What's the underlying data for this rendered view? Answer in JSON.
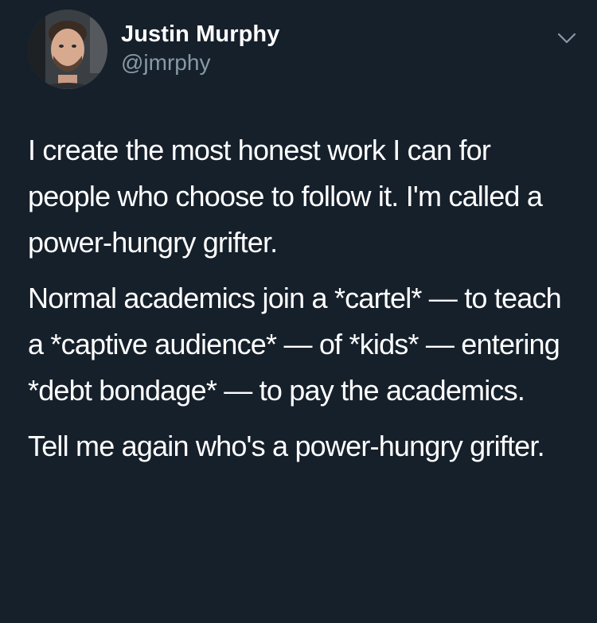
{
  "tweet": {
    "author": {
      "display_name": "Justin Murphy",
      "handle": "@jmrphy"
    },
    "icons": {
      "avatar": "profile-photo",
      "menu": "chevron-down-icon"
    },
    "paragraphs": [
      "I create the most honest work I can for people who choose to follow it. I'm called a power-hungry grifter.",
      "Normal academics join a *cartel* — to teach a *captive audience* — of *kids* — entering *debt bondage* — to pay the academics.",
      "Tell me again who's a power-hungry grifter."
    ]
  },
  "colors": {
    "background": "#16202b",
    "text": "#ffffff",
    "secondary_text": "#8899a6"
  }
}
